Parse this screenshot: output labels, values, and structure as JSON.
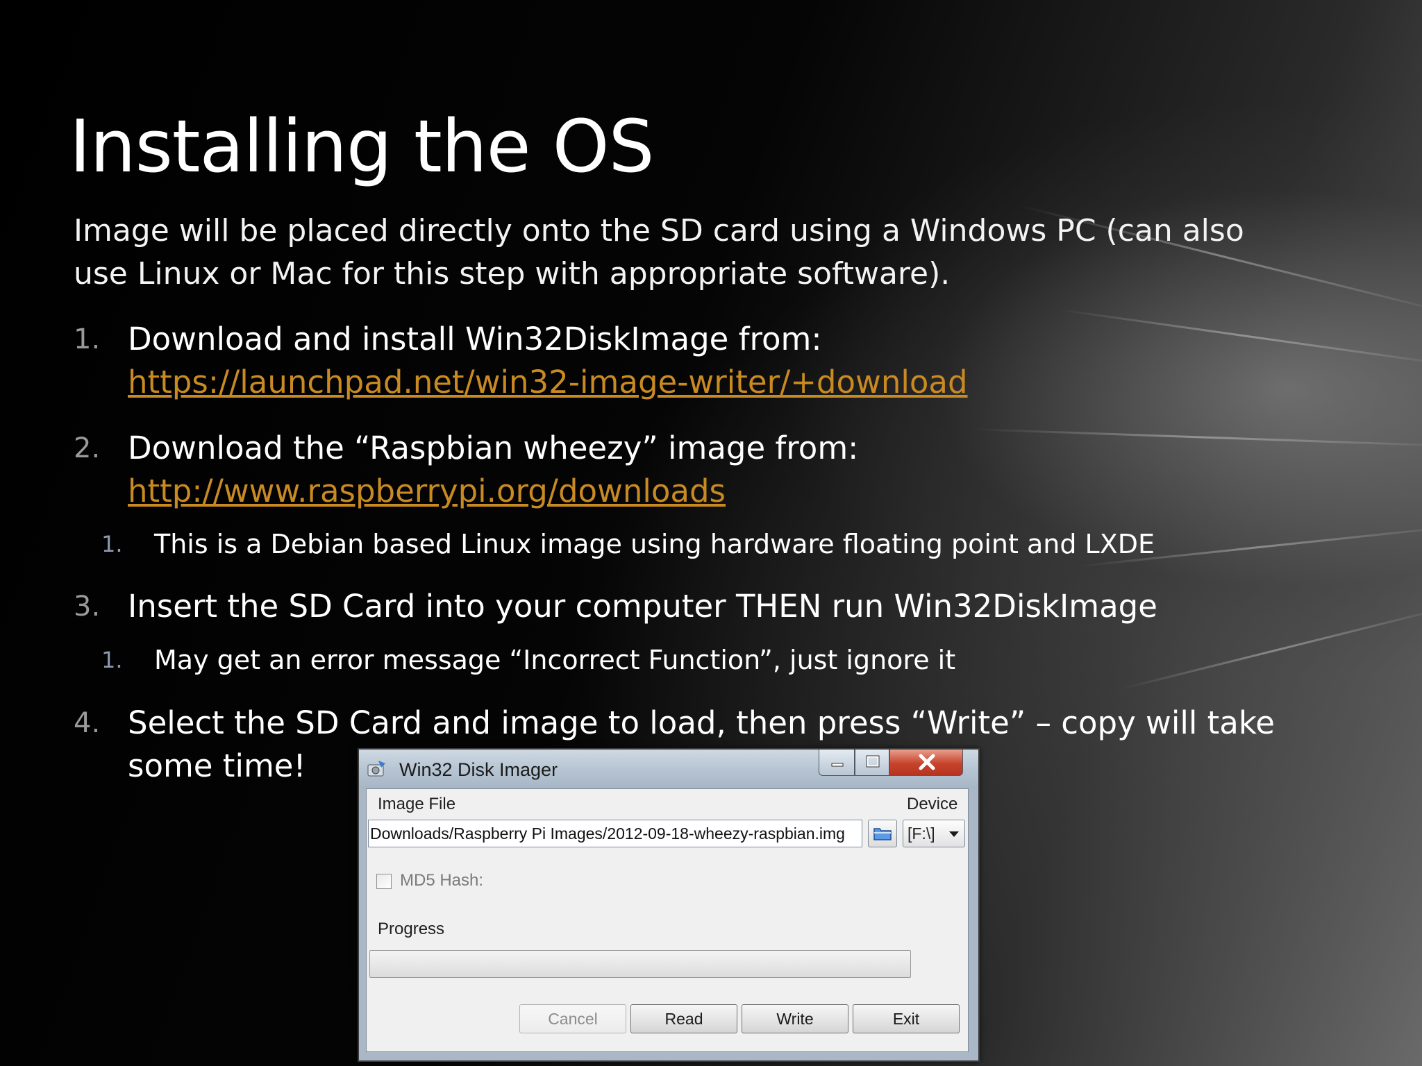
{
  "slide": {
    "title": "Installing the OS",
    "intro": "Image will be placed directly onto the SD card using a Windows PC (can also use Linux or Mac for this step with appropriate software).",
    "steps": [
      {
        "num": "1.",
        "text": "Download and install Win32DiskImage from:",
        "link": "https://launchpad.net/win32-image-writer/+download"
      },
      {
        "num": "2.",
        "text": "Download the “Raspbian wheezy” image from:",
        "link": "http://www.raspberrypi.org/downloads",
        "sub": {
          "num": "1.",
          "text": "This is a Debian based Linux image using hardware floating point and LXDE"
        }
      },
      {
        "num": "3.",
        "text": "Insert the SD Card into your computer THEN run Win32DiskImage",
        "sub": {
          "num": "1.",
          "text": "May get an error message “Incorrect Function”, just ignore it"
        }
      },
      {
        "num": "4.",
        "text": "Select the SD Card and image to load, then press “Write” – copy will take",
        "text2": "some time!"
      }
    ],
    "link_color": "#c98a22"
  },
  "dialog": {
    "title": "Win32 Disk Imager",
    "image_file_label": "Image File",
    "image_file_value": "Downloads/Raspberry Pi Images/2012-09-18-wheezy-raspbian.img",
    "device_label": "Device",
    "device_value": "[F:\\]",
    "md5_label": "MD5 Hash:",
    "md5_checked": false,
    "progress_label": "Progress",
    "progress_value": 0,
    "buttons": {
      "cancel": "Cancel",
      "read": "Read",
      "write": "Write",
      "exit": "Exit"
    },
    "icons": {
      "app": "disk-imager-icon",
      "browse": "folder-icon",
      "minimize": "minimize-icon",
      "maximize": "maximize-icon",
      "close": "close-icon"
    }
  }
}
